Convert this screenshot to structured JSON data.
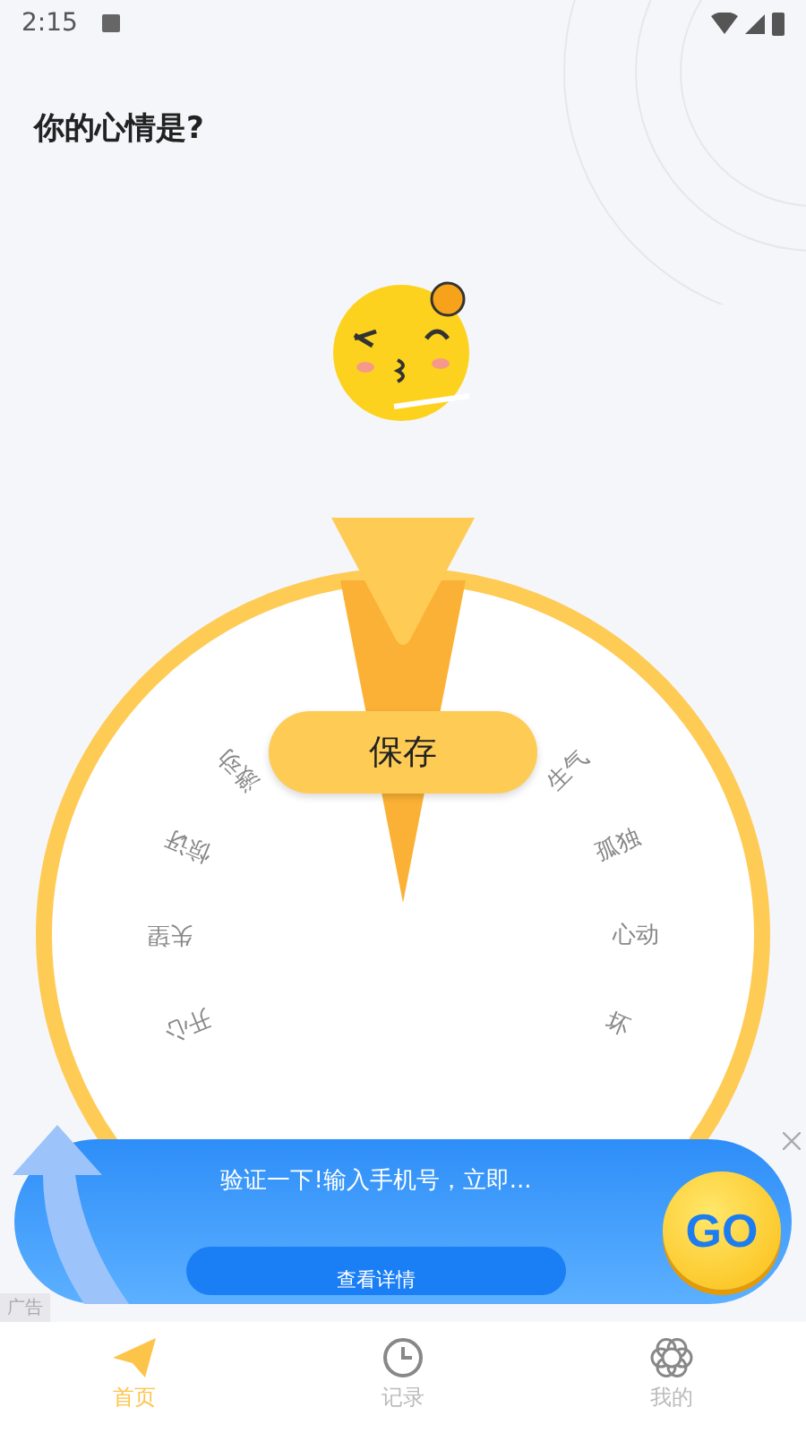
{
  "status_bar": {
    "time": "2:15"
  },
  "title": "你的心情是?",
  "wheel": {
    "labels": [
      "生气",
      "孤独",
      "心动",
      "坏",
      "开心",
      "失望",
      "惊讶",
      "激动"
    ],
    "save_button": "保存"
  },
  "ad": {
    "text": "验证一下!输入手机号，立即...",
    "button": "查看详情",
    "badge": "GO",
    "tag": "广告"
  },
  "nav": [
    {
      "label": "首页",
      "selected": true,
      "kind": "plane"
    },
    {
      "label": "记录",
      "selected": false,
      "kind": "clock"
    },
    {
      "label": "我的",
      "selected": false,
      "kind": "flower"
    }
  ]
}
